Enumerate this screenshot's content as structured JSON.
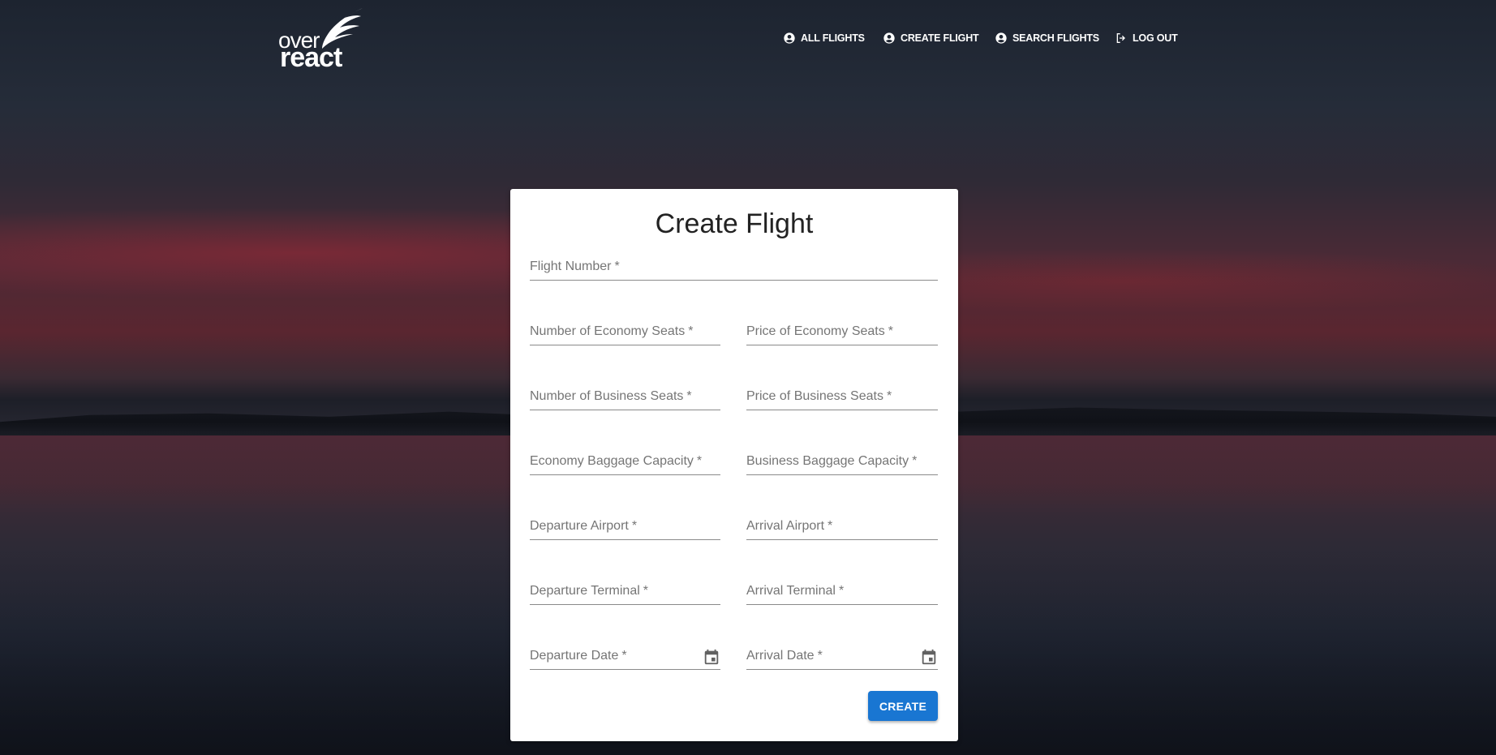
{
  "header": {
    "logo_over": "over",
    "logo_react": "react",
    "nav": {
      "all_flights": "ALL FLIGHTS",
      "create_flight": "CREATE FLIGHT",
      "search_flights": "SEARCH FLIGHTS",
      "log_out": "LOG OUT"
    }
  },
  "form": {
    "title": "Create Flight",
    "required_marker": "*",
    "flight_number": "Flight Number",
    "economy_seats": "Number of Economy Seats",
    "economy_price": "Price of Economy Seats",
    "business_seats": "Number of Business Seats",
    "business_price": "Price of Business Seats",
    "economy_baggage": "Economy Baggage Capacity",
    "business_baggage": "Business Baggage Capacity",
    "departure_airport": "Departure Airport",
    "arrival_airport": "Arrival Airport",
    "departure_terminal": "Departure Terminal",
    "arrival_terminal": "Arrival Terminal",
    "departure_date": "Departure Date",
    "arrival_date": "Arrival Date",
    "submit_label": "CREATE"
  },
  "colors": {
    "primary": "#1976d2",
    "card_bg": "#ffffff",
    "label": "#757575"
  },
  "icons": [
    "account-circle-icon",
    "logout-icon",
    "calendar-icon",
    "wing-logo-icon"
  ]
}
